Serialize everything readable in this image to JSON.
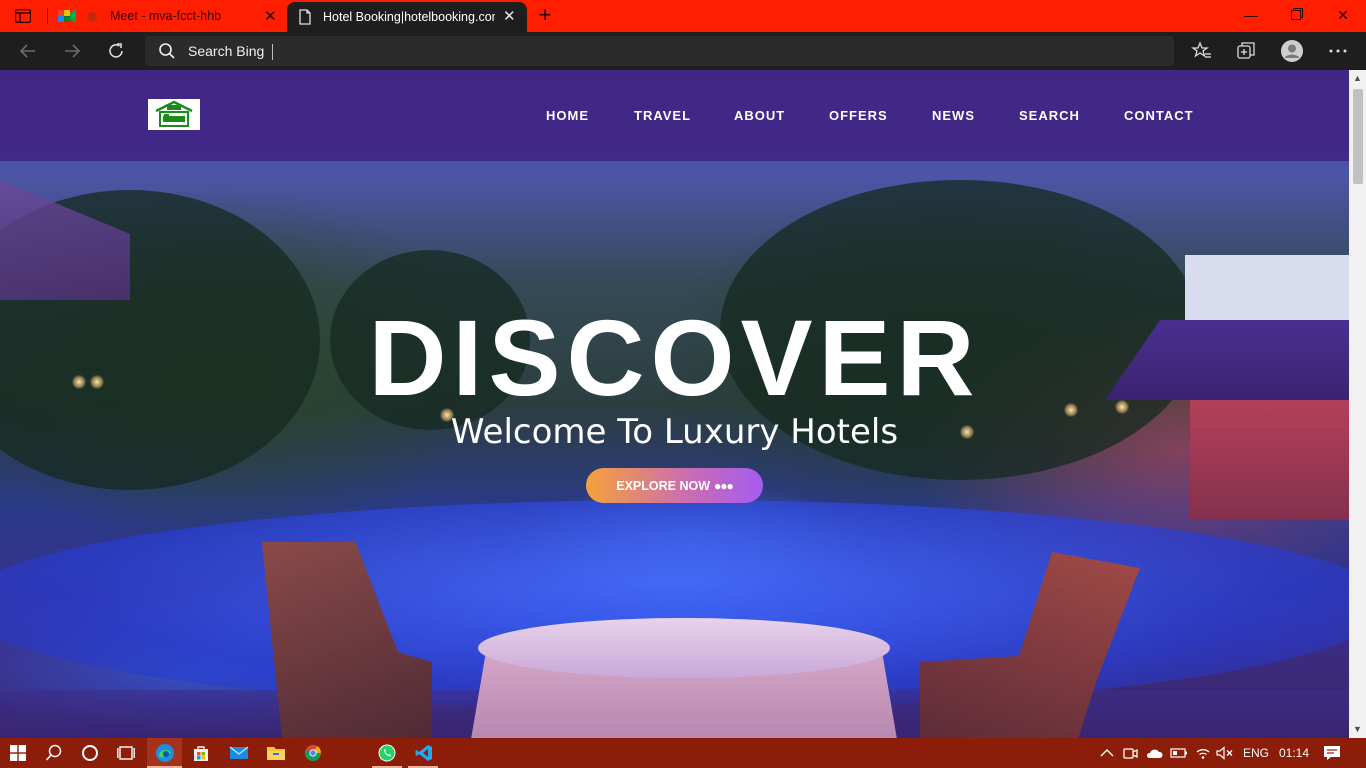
{
  "browser": {
    "tabs": [
      {
        "title": "Meet - mva-fcct-hhb",
        "active": false,
        "favicon": "google-meet-icon"
      },
      {
        "title": "Hotel Booking|hotelbooking.com",
        "active": true,
        "favicon": "page-icon"
      }
    ],
    "address_bar": {
      "placeholder": "Search Bing"
    },
    "window_controls": [
      "minimize",
      "restore",
      "close"
    ],
    "tab_strip_color": "#ff1e00"
  },
  "site": {
    "nav": [
      "HOME",
      "TRAVEL",
      "ABOUT",
      "OFFERS",
      "NEWS",
      "SEARCH",
      "CONTACT"
    ],
    "hero": {
      "title": "DISCOVER",
      "subtitle": "Welcome To Luxury Hotels",
      "cta_label": "EXPLORE NOW",
      "cta_dots": "●●●"
    },
    "header_color": "#40228299"
  },
  "taskbar": {
    "pinned": [
      "windows-start-icon",
      "search-icon",
      "cortana-icon",
      "task-view-icon",
      "edge-icon",
      "store-icon",
      "mail-icon",
      "file-explorer-icon",
      "chrome-icon",
      "whatsapp-icon",
      "vscode-icon"
    ],
    "tray": {
      "language": "ENG",
      "time": "01:14"
    },
    "color": "#8c1d08"
  }
}
